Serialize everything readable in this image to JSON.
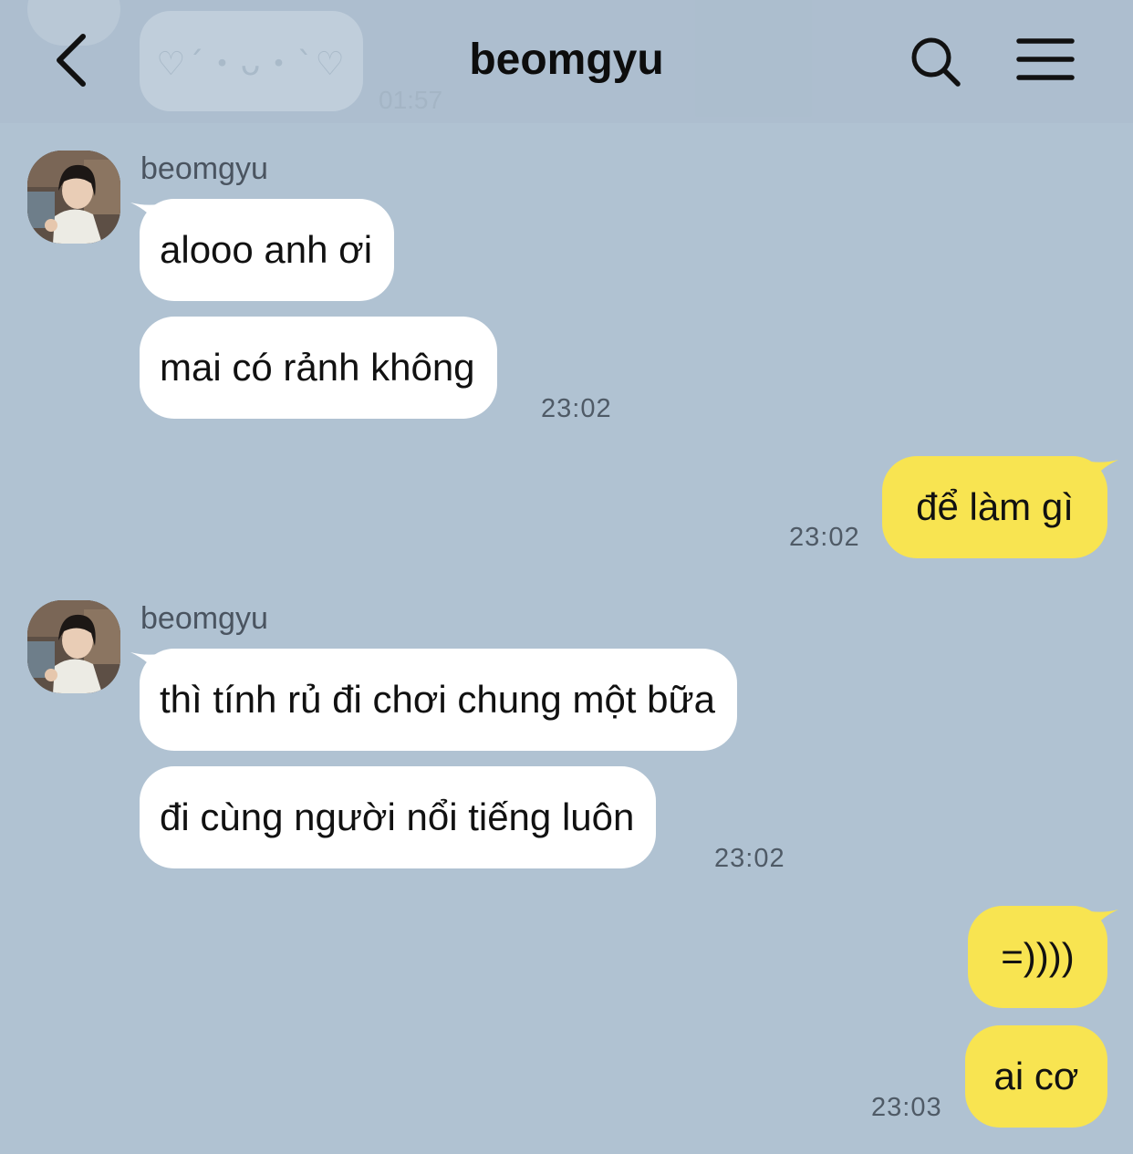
{
  "header": {
    "title": "beomgyu",
    "prev_message_emoticon": "♡´・ᴗ・`♡",
    "prev_message_time": "01:57"
  },
  "messages": [
    {
      "sender": "beomgyu",
      "text": "alooo anh ơi"
    },
    {
      "sender": "beomgyu",
      "text": "mai có rảnh không",
      "time": "23:02"
    },
    {
      "sender": "me",
      "text": "để làm gì",
      "time": "23:02"
    },
    {
      "sender": "beomgyu",
      "text": "thì tính rủ đi chơi chung một bữa"
    },
    {
      "sender": "beomgyu",
      "text": "đi cùng người nổi tiếng luôn",
      "time": "23:02"
    },
    {
      "sender": "me",
      "text": "=))))"
    },
    {
      "sender": "me",
      "text": "ai cơ",
      "time": "23:03"
    }
  ],
  "colors": {
    "background": "#b0c2d2",
    "incoming_bubble": "#ffffff",
    "outgoing_bubble": "#f8e451"
  }
}
